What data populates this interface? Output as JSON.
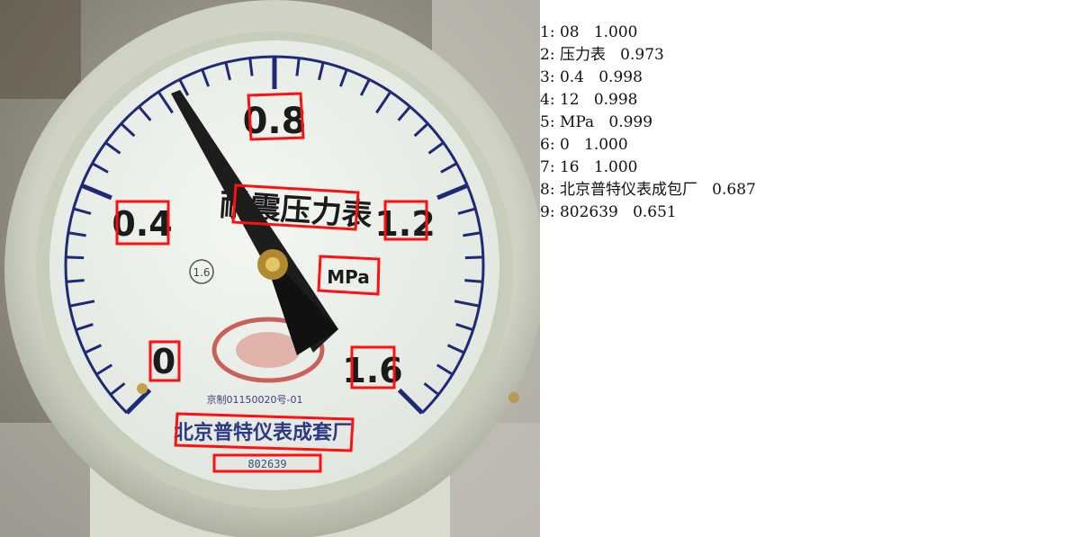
{
  "gauge": {
    "dial_labels": [
      "0.8",
      "0.4",
      "1.2",
      "0",
      "1.6"
    ],
    "unit": "MPa",
    "title": "耐震压力表",
    "maker": "北京普特仪表成套厂",
    "serial": "802639",
    "accuracy_class": "1.6",
    "cert_text": "京制01150020号-01"
  },
  "detections": [
    {
      "index": "1:",
      "text": "08",
      "score": "1.000"
    },
    {
      "index": "2:",
      "text": "压力表",
      "score": "0.973"
    },
    {
      "index": "3:",
      "text": "0.4",
      "score": "0.998"
    },
    {
      "index": "4:",
      "text": "12",
      "score": "0.998"
    },
    {
      "index": "5:",
      "text": "MPa",
      "score": "0.999"
    },
    {
      "index": "6:",
      "text": "0",
      "score": "1.000"
    },
    {
      "index": "7:",
      "text": "16",
      "score": "1.000"
    },
    {
      "index": "8:",
      "text": "北京普特仪表成包厂",
      "score": "0.687"
    },
    {
      "index": "9:",
      "text": "802639",
      "score": "0.651"
    }
  ],
  "colors": {
    "box": "#ff1010",
    "dial_ink": "#1e2a78",
    "dial_face": "#eef2ea"
  }
}
